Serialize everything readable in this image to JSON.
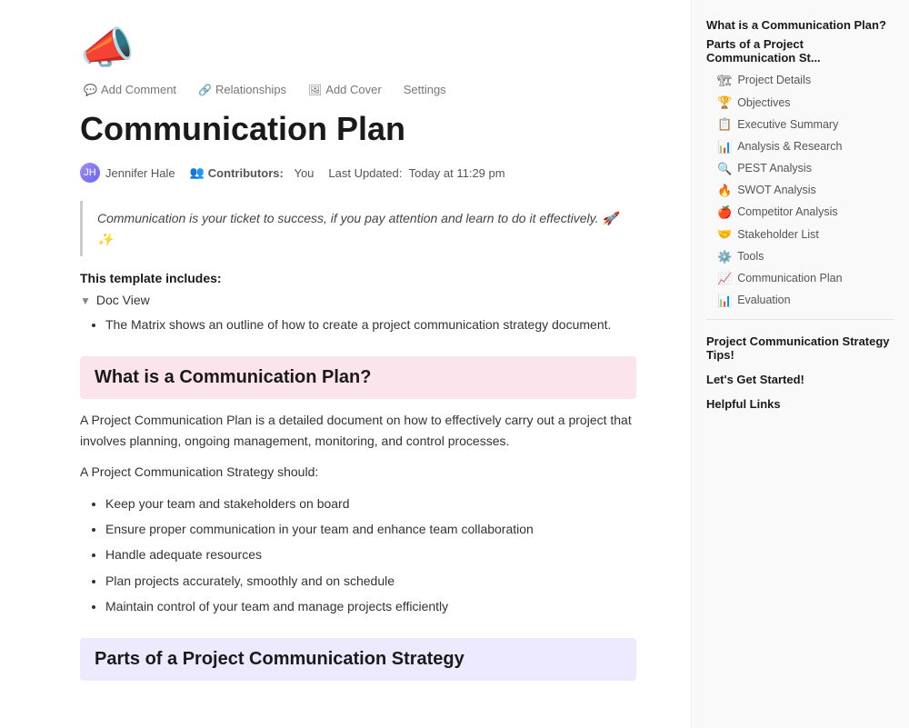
{
  "toolbar": {
    "add_comment_label": "Add Comment",
    "relationships_label": "Relationships",
    "add_cover_label": "Add Cover",
    "settings_label": "Settings"
  },
  "page": {
    "icon": "📣",
    "title": "Communication Plan",
    "author_name": "Jennifer Hale",
    "contributors_label": "Contributors:",
    "contributors_value": "You",
    "last_updated_label": "Last Updated:",
    "last_updated_value": "Today at 11:29 pm"
  },
  "quote": {
    "text": "Communication is your ticket to success, if you pay attention and learn to do it effectively. 🚀✨"
  },
  "template_includes": {
    "label": "This template includes:",
    "toggle_label": "Doc View",
    "matrix_text": "The Matrix shows an outline of how to create a project communication strategy document."
  },
  "section1": {
    "heading": "What is a Communication Plan?",
    "paragraph1": "A Project Communication Plan is a detailed document on how to effectively carry out a project that involves planning, ongoing management, monitoring, and control processes.",
    "paragraph2": "A Project Communication Strategy should:",
    "bullets": [
      "Keep your team and stakeholders on board",
      "Ensure proper communication in your team and enhance team collaboration",
      "Handle adequate resources",
      "Plan projects accurately, smoothly and on schedule",
      "Maintain control of your team and manage projects efficiently"
    ]
  },
  "section2": {
    "heading": "Parts of a Project Communication Strategy"
  },
  "sidebar": {
    "top_link": "What is a Communication Plan?",
    "parts_link": "Parts of a Project Communication St...",
    "items": [
      {
        "emoji": "🏗",
        "label": "Project Details"
      },
      {
        "emoji": "🏆",
        "label": "Objectives"
      },
      {
        "emoji": "📋",
        "label": "Executive Summary"
      },
      {
        "emoji": "📊",
        "label": "Analysis & Research"
      },
      {
        "emoji": "🔍",
        "label": "PEST Analysis"
      },
      {
        "emoji": "🔥",
        "label": "SWOT Analysis"
      },
      {
        "emoji": "🍎",
        "label": "Competitor Analysis"
      },
      {
        "emoji": "🤝",
        "label": "Stakeholder List"
      },
      {
        "emoji": "⚙️",
        "label": "Tools"
      },
      {
        "emoji": "📈",
        "label": "Communication Plan"
      },
      {
        "emoji": "📊",
        "label": "Evaluation"
      }
    ],
    "group2": "Project Communication Strategy Tips!",
    "group3": "Let's Get Started!",
    "group4": "Helpful Links"
  }
}
